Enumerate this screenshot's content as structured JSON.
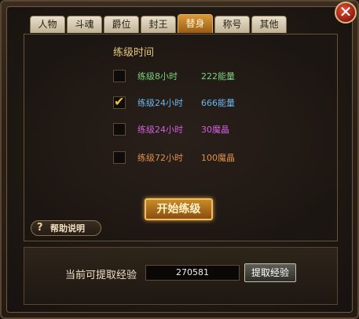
{
  "tabs": [
    "人物",
    "斗魂",
    "爵位",
    "封王",
    "替身",
    "称号",
    "其他"
  ],
  "active_tab": 4,
  "close_icon": "close-icon",
  "section_title": "练级时间",
  "options": [
    {
      "label": "练级8小时",
      "cost": "222能量",
      "checked": false,
      "label_color": "#7ad27a",
      "cost_color": "#7ad27a"
    },
    {
      "label": "练级24小时",
      "cost": "666能量",
      "checked": true,
      "label_color": "#6ab8f0",
      "cost_color": "#6ab8f0"
    },
    {
      "label": "练级24小时",
      "cost": "30魔晶",
      "checked": false,
      "label_color": "#d060e0",
      "cost_color": "#d060e0"
    },
    {
      "label": "练级72小时",
      "cost": "100魔晶",
      "checked": false,
      "label_color": "#e0904a",
      "cost_color": "#e0904a"
    }
  ],
  "start_button": "开始练级",
  "help_label": "帮助说明",
  "exp_label": "当前可提取经验",
  "exp_value": "270581",
  "extract_button": "提取经验",
  "check_mark": "✔"
}
